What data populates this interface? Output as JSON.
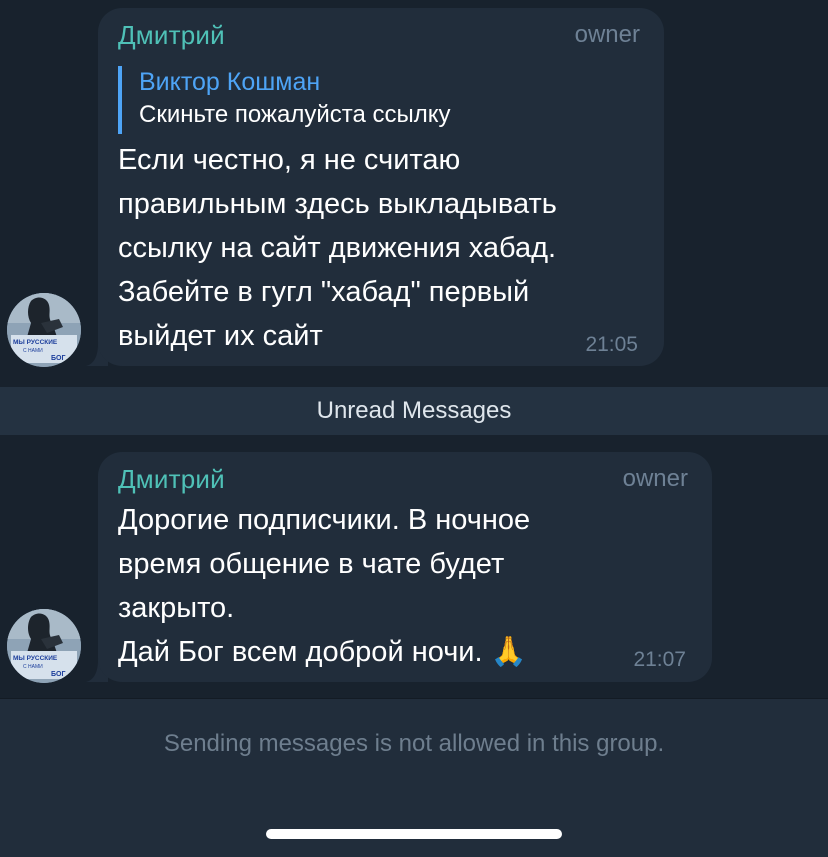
{
  "messages": [
    {
      "sender": "Дмитрий",
      "role": "owner",
      "reply": {
        "name": "Виктор Кошман",
        "text": "Скиньте пожалуйста ссылку"
      },
      "lines": [
        "Если честно, я не считаю",
        "правильным здесь выкладывать",
        "ссылку на сайт движения хабад.",
        "Забейте в гугл \"хабад\" первый",
        "выйдет их сайт"
      ],
      "time": "21:05"
    },
    {
      "sender": "Дмитрий",
      "role": "owner",
      "lines": [
        "Дорогие подписчики. В ночное",
        "время общение в чате будет",
        "закрыто.",
        "Дай Бог всем доброй ночи."
      ],
      "emoji": "🙏",
      "time": "21:07"
    }
  ],
  "avatar_sign": {
    "line1": "МЫ РУССКИЕ",
    "line2": "С НАМИ",
    "line3": "БОГ"
  },
  "unread_label": "Unread Messages",
  "footer_text": "Sending messages is not allowed in this group.",
  "colors": {
    "background": "#18222d",
    "bubble": "#212d3b",
    "sender": "#4fc1b7",
    "reply_accent": "#4ea4f6",
    "meta": "#6e8195"
  }
}
